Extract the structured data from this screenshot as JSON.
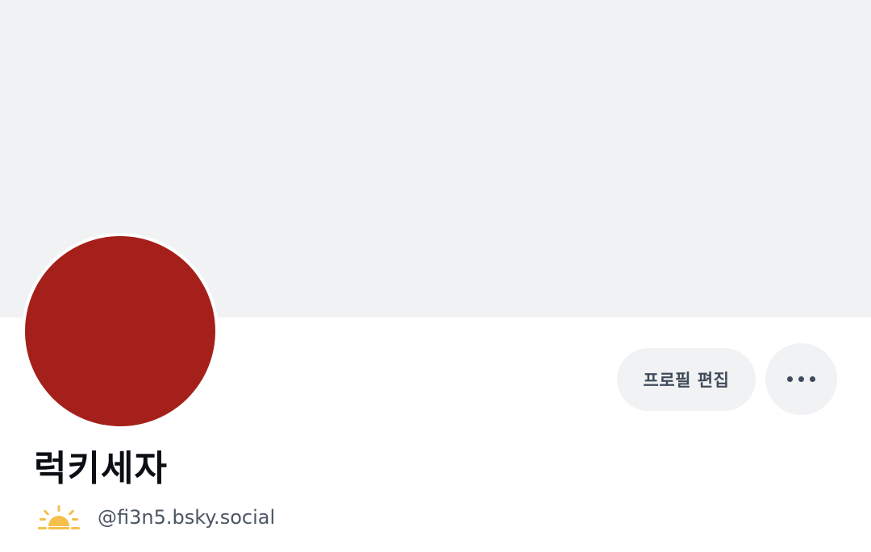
{
  "profile": {
    "display_name": "럭키세자",
    "handle": "@fi3n5.bsky.social",
    "avatar_color": "#a5201b",
    "badge_icon": "sun-icon"
  },
  "actions": {
    "edit_label": "프로필 편집",
    "more_icon": "ellipsis-icon"
  },
  "colors": {
    "banner": "#f1f2f4",
    "button_bg": "#f1f2f4",
    "button_text": "#3f4a5a",
    "sun": "#f4c04a"
  }
}
